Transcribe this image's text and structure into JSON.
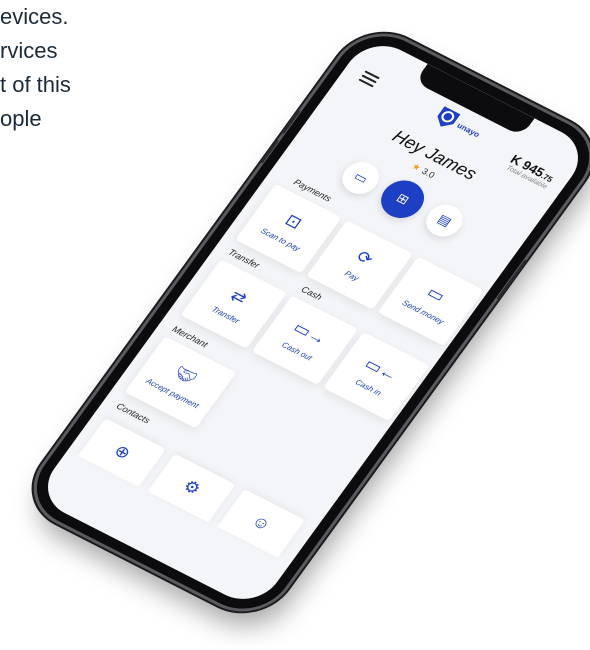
{
  "background_text": [
    "evices.",
    "rvices",
    "t of this",
    "ople"
  ],
  "app": {
    "brand": "unayo",
    "balance_main": "K 945",
    "balance_cents": ".75",
    "balance_label": "Total available",
    "greeting": "Hey James",
    "rating": "3.0"
  },
  "sections": {
    "payments": "Payments",
    "transfer": "Transfer",
    "cash": "Cash",
    "merchant": "Merchant",
    "contacts": "Contacts"
  },
  "tiles": {
    "scan_to_pay": "Scan to pay",
    "pay": "Pay",
    "send_money": "Send money",
    "transfer": "Transfer",
    "cash_out": "Cash out",
    "cash_in": "Cash in",
    "accept_payment": "Accept payment"
  },
  "icons": {
    "menu": "menu-icon",
    "profile_card": "id-card-icon",
    "grid": "grid-icon",
    "statement": "document-icon",
    "star": "star-icon",
    "qr": "qr-scan-icon",
    "pay": "wallet-icon",
    "send": "send-money-icon",
    "transfer": "transfer-arrows-icon",
    "cash_out": "cash-out-icon",
    "cash_in": "cash-in-icon",
    "handshake": "handshake-icon",
    "add_contact": "add-contact-icon",
    "contact_settings": "contact-settings-icon",
    "contact_link": "contact-link-icon"
  },
  "colors": {
    "accent": "#1d3fc4",
    "star": "#f0a020",
    "screen_bg": "#f4f5f8"
  }
}
